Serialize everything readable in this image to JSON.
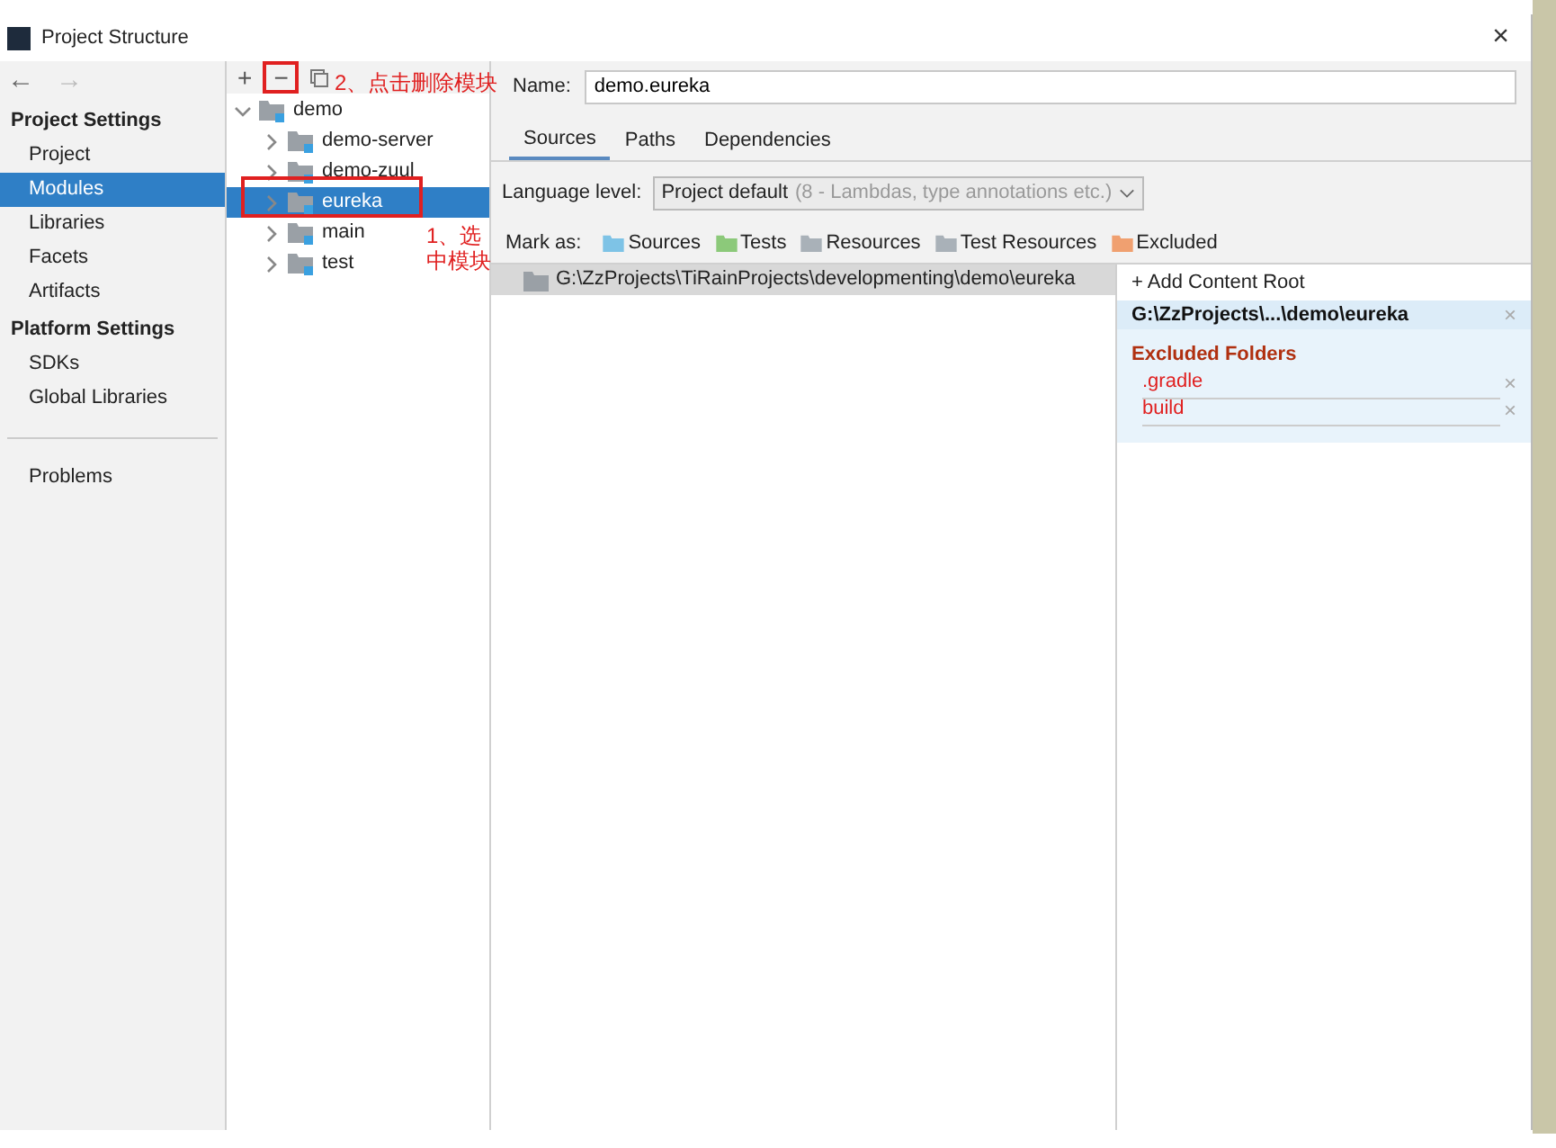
{
  "window": {
    "title": "Project Structure",
    "close": "×"
  },
  "nav": {
    "back": "←",
    "forward": "→"
  },
  "sidebar": {
    "sections": [
      {
        "title": "Project Settings",
        "items": [
          {
            "label": "Project",
            "selected": false
          },
          {
            "label": "Modules",
            "selected": true
          },
          {
            "label": "Libraries",
            "selected": false
          },
          {
            "label": "Facets",
            "selected": false
          },
          {
            "label": "Artifacts",
            "selected": false
          }
        ]
      },
      {
        "title": "Platform Settings",
        "items": [
          {
            "label": "SDKs",
            "selected": false
          },
          {
            "label": "Global Libraries",
            "selected": false
          }
        ]
      },
      {
        "items": [
          {
            "label": "Problems",
            "selected": false
          }
        ]
      }
    ]
  },
  "toolbar": {
    "add": "+",
    "remove": "−"
  },
  "tree": [
    {
      "label": "demo",
      "expanded": true,
      "selected": false,
      "children": [
        {
          "label": "demo-server",
          "expanded": false,
          "selected": false
        },
        {
          "label": "demo-zuul",
          "expanded": false,
          "selected": false
        },
        {
          "label": "eureka",
          "expanded": false,
          "selected": true
        },
        {
          "label": "main",
          "expanded": false,
          "selected": false
        },
        {
          "label": "test",
          "expanded": false,
          "selected": false
        }
      ]
    }
  ],
  "name_field": {
    "label": "Name:",
    "value": "demo.eureka"
  },
  "tabs": [
    {
      "label": "Sources",
      "selected": true
    },
    {
      "label": "Paths",
      "selected": false
    },
    {
      "label": "Dependencies",
      "selected": false
    }
  ],
  "language_level": {
    "label": "Language level:",
    "value": "Project default",
    "hint": "(8 - Lambdas, type annotations etc.)"
  },
  "mark_as": {
    "label": "Mark as:",
    "items": [
      {
        "label": "Sources",
        "color": "#7ec3e6"
      },
      {
        "label": "Tests",
        "color": "#8cc97a"
      },
      {
        "label": "Resources",
        "color": "#a9b1b8"
      },
      {
        "label": "Test Resources",
        "color": "#a9b1b8"
      },
      {
        "label": "Excluded",
        "color": "#f0a070"
      }
    ]
  },
  "content_tree": {
    "path": "G:\\ZzProjects\\TiRainProjects\\developmenting\\demo\\eureka"
  },
  "content_root": {
    "add": "+ Add Content Root",
    "root": "G:\\ZzProjects\\...\\demo\\eureka",
    "excluded_title": "Excluded Folders",
    "excluded": [
      ".gradle",
      "build"
    ],
    "remove": "×"
  },
  "annotations": [
    {
      "text": "2、点击删除模块"
    },
    {
      "text": "1、选中模块"
    }
  ]
}
